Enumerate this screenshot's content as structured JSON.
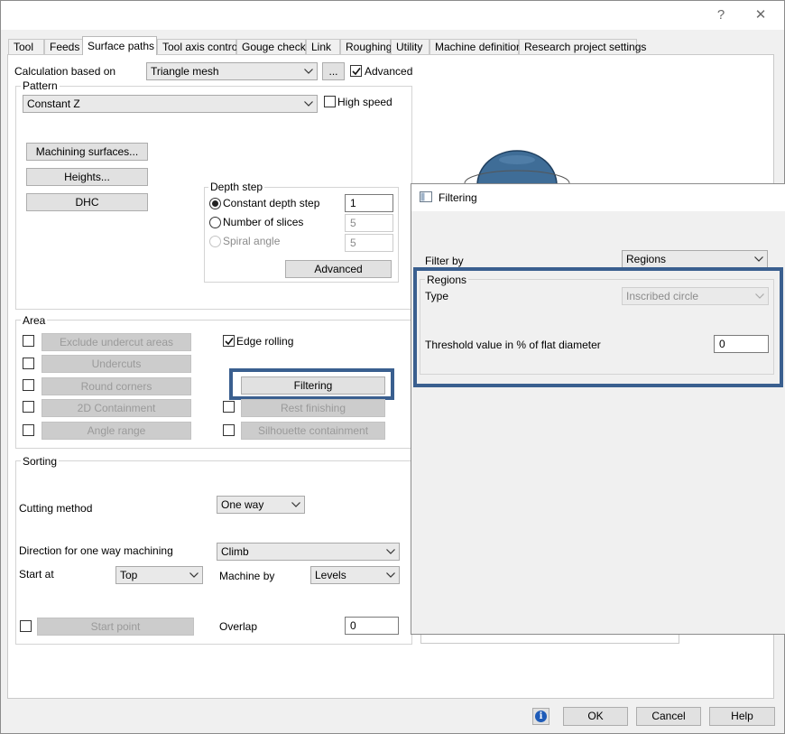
{
  "window": {
    "help_glyph": "?",
    "close_glyph": "✕"
  },
  "tabs": [
    {
      "label": "Tool"
    },
    {
      "label": "Feeds"
    },
    {
      "label": "Surface paths"
    },
    {
      "label": "Tool axis control"
    },
    {
      "label": "Gouge check"
    },
    {
      "label": "Link"
    },
    {
      "label": "Roughing"
    },
    {
      "label": "Utility"
    },
    {
      "label": "Machine definition"
    },
    {
      "label": "Research project settings"
    }
  ],
  "calc": {
    "label": "Calculation based on",
    "value": "Triangle mesh",
    "more_button": "...",
    "advanced_label": "Advanced",
    "advanced_checked": true
  },
  "pattern": {
    "group_label": "Pattern",
    "value": "Constant Z",
    "high_speed_label": "High speed",
    "buttons": {
      "machining_surfaces": "Machining surfaces...",
      "heights": "Heights...",
      "dhc": "DHC"
    }
  },
  "depth_step": {
    "group_label": "Depth step",
    "constant_label": "Constant depth step",
    "constant_value": "1",
    "slices_label": "Number of slices",
    "slices_value": "5",
    "spiral_label": "Spiral angle",
    "spiral_value": "5",
    "advanced_button": "Advanced"
  },
  "area": {
    "group_label": "Area",
    "exclude_undercut": "Exclude undercut areas",
    "undercuts": "Undercuts",
    "round_corners": "Round corners",
    "containment_2d": "2D Containment",
    "angle_range": "Angle range",
    "edge_rolling_label": "Edge rolling",
    "edge_rolling_checked": true,
    "filtering": "Filtering",
    "rest_finishing": "Rest finishing",
    "silhouette": "Silhouette containment"
  },
  "sorting": {
    "group_label": "Sorting",
    "cutting_method_label": "Cutting method",
    "cutting_method_value": "One way",
    "direction_label": "Direction for one way machining",
    "direction_value": "Climb",
    "start_at_label": "Start at",
    "start_at_value": "Top",
    "machine_by_label": "Machine by",
    "machine_by_value": "Levels",
    "start_point_button": "Start point",
    "overlap_label": "Overlap",
    "overlap_value": "0"
  },
  "filtering_dialog": {
    "title": "Filtering",
    "filter_by_label": "Filter by",
    "filter_by_value": "Regions",
    "regions_group": "Regions",
    "type_label": "Type",
    "type_value": "Inscribed circle",
    "threshold_label": "Threshold value in % of flat diameter",
    "threshold_value": "0"
  },
  "footer": {
    "info_glyph": "i",
    "ok": "OK",
    "cancel": "Cancel",
    "help": "Help"
  },
  "colors": {
    "highlight": "#3a5f8f",
    "preview_sphere": "#3f6d97",
    "info_icon": "#1e5bb8"
  }
}
